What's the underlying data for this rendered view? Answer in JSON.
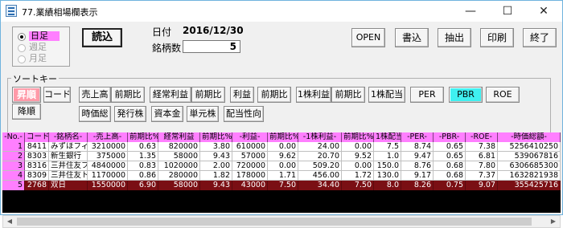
{
  "window": {
    "title": "77.業績相場欄表示",
    "minimize": "—",
    "maximize": "☐",
    "close": "✕"
  },
  "period": {
    "options": [
      "日足",
      "週足",
      "月足"
    ],
    "selected": "日足"
  },
  "load_button": "読込",
  "date_label": "日付",
  "date_value": "2016/12/30",
  "count_label": "銘柄数",
  "count_value": "5",
  "actions": [
    "OPEN",
    "書込",
    "抽出",
    "印刷",
    "終了"
  ],
  "sort": {
    "title": "ソートキー",
    "asc": "昇順",
    "desc": "降順",
    "keys_row1": [
      "コード",
      "売上高",
      "前期比",
      "経常利益",
      "前期比",
      "利益",
      "前期比",
      "1株利益",
      "前期比",
      "1株配当",
      "PER",
      "PBR",
      "ROE"
    ],
    "keys_row2": [
      "時価総",
      "発行株",
      "資本金",
      "単元株",
      "配当性向"
    ],
    "active_key": "PBR"
  },
  "table": {
    "columns": [
      "-No.-",
      "コード",
      "-銘柄名-",
      "-売上高-",
      "前期比%",
      "経常利益",
      "前期比%",
      "-利益-",
      "前期比%",
      "-1株利益-",
      "前期比%",
      "1株配当",
      "-PER-",
      "-PBR-",
      "-ROE-",
      "-時価総額-"
    ],
    "rows": [
      [
        "1",
        "8411",
        "みずほフィナ",
        "3210000",
        "0.63",
        "820000",
        "3.80",
        "610000",
        "0.00",
        "24.00",
        "0.00",
        "7.5",
        "8.74",
        "0.65",
        "7.38",
        "5256410250"
      ],
      [
        "2",
        "8303",
        "新生銀行",
        "375000",
        "1.35",
        "58000",
        "9.43",
        "57000",
        "9.62",
        "20.70",
        "9.52",
        "1.0",
        "9.47",
        "0.65",
        "6.81",
        "539067816"
      ],
      [
        "3",
        "8316",
        "三井住友フィ",
        "4840000",
        "0.83",
        "1020000",
        "2.00",
        "720000",
        "0.00",
        "509.20",
        "0.00",
        "150.0",
        "8.76",
        "0.68",
        "7.80",
        "6306685300"
      ],
      [
        "4",
        "8309",
        "三井住友トラ",
        "1170000",
        "0.86",
        "280000",
        "1.82",
        "178000",
        "1.71",
        "456.00",
        "1.72",
        "130.0",
        "9.17",
        "0.68",
        "7.37",
        "1632821938"
      ]
    ],
    "summary": [
      "5",
      "2768",
      "双日",
      "1550000",
      "6.90",
      "58000",
      "9.43",
      "43000",
      "7.50",
      "34.40",
      "7.50",
      "8.0",
      "8.26",
      "0.75",
      "9.07",
      "355425716"
    ]
  },
  "colors": {
    "header_bg": "#ff7fff",
    "summary_bg": "#7a0f14",
    "sort_dir_bg": "#ff9aa8",
    "active_key_bg": "#3ff0f0"
  }
}
